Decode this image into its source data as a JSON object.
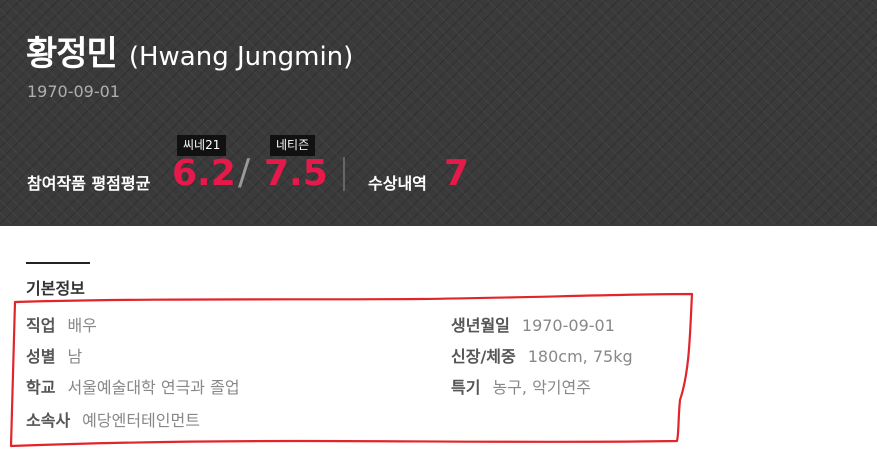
{
  "profile": {
    "name_ko": "황정민",
    "name_en": "(Hwang Jungmin)",
    "birth": "1970-09-01"
  },
  "ratings": {
    "avg_label": "참여작품 평점평균",
    "cine21_tag": "씨네21",
    "cine21_score": "6.2",
    "separator": "/",
    "netizen_tag": "네티즌",
    "netizen_score": "7.5",
    "award_label": "수상내역",
    "award_count": "7"
  },
  "basic_info": {
    "section_title": "기본정보",
    "job_label": "직업",
    "job_value": "배우",
    "gender_label": "성별",
    "gender_value": "남",
    "school_label": "학교",
    "school_value": "서울예술대학 연극과 졸업",
    "agency_label": "소속사",
    "agency_value": "예당엔터테인먼트",
    "birth_label": "생년월일",
    "birth_value": "1970-09-01",
    "body_label": "신장/체중",
    "body_value": "180cm, 75kg",
    "skill_label": "특기",
    "skill_value": "농구, 악기연주"
  },
  "colors": {
    "accent": "#e6194b",
    "annotation": "#e0262c"
  }
}
